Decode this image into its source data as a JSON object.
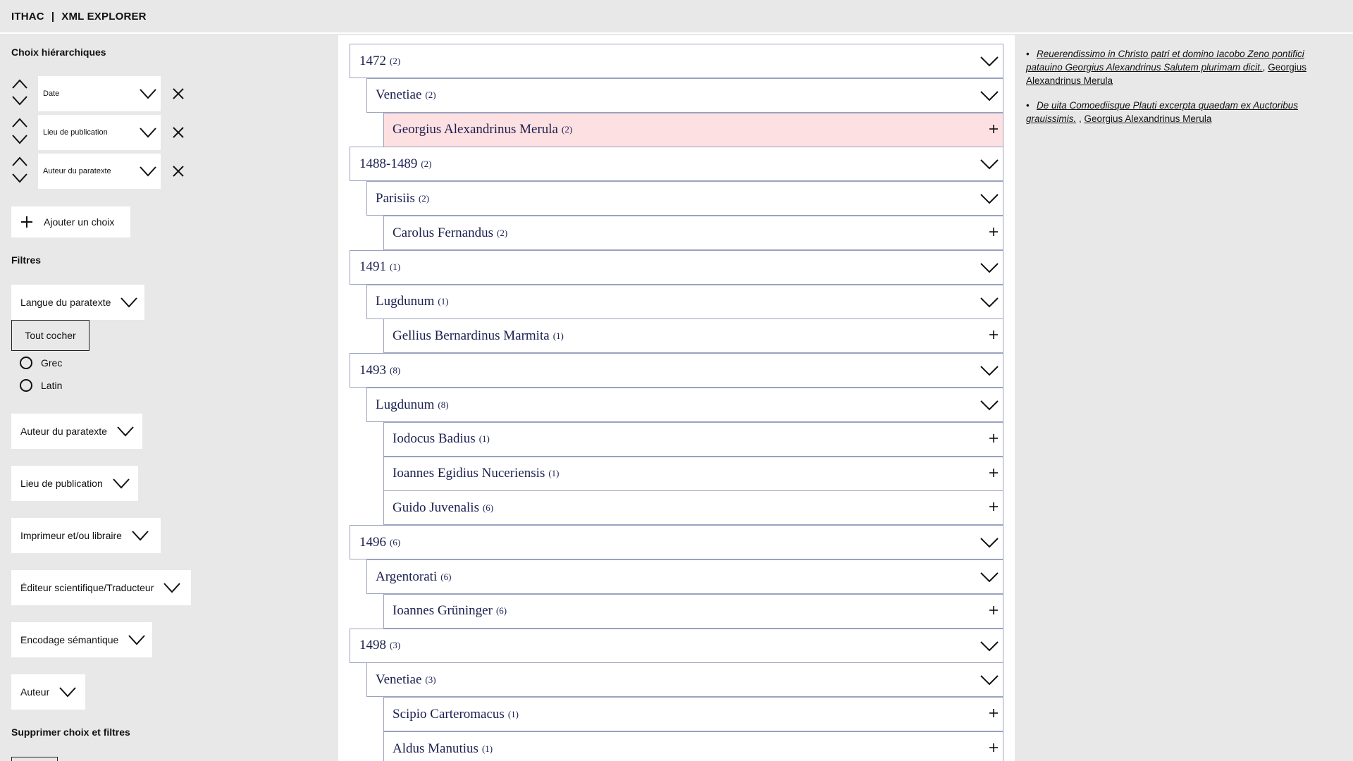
{
  "header": {
    "brand": "ITHAC",
    "separator": "|",
    "title": "XML EXPLORER"
  },
  "left": {
    "hier_title": "Choix hiérarchiques",
    "hier_choices": [
      "Date",
      "Lieu de publication",
      "Auteur du paratexte"
    ],
    "add_label": "Ajouter un choix",
    "filters_title": "Filtres",
    "filters": [
      "Langue du paratexte",
      "Auteur du paratexte",
      "Lieu de publication",
      "Imprimeur et/ou libraire",
      "Éditeur scientifique/Traducteur",
      "Encodage sémantique",
      "Auteur"
    ],
    "tout_cocher": "Tout cocher",
    "langues": [
      "Grec",
      "Latin"
    ],
    "reset_title": "Supprimer choix et filtres"
  },
  "tree": [
    {
      "level": 0,
      "label": "1472",
      "count": "(2)",
      "type": "expand"
    },
    {
      "level": 1,
      "label": "Venetiae",
      "count": "(2)",
      "type": "expand"
    },
    {
      "level": 2,
      "label": "Georgius Alexandrinus Merula",
      "count": "(2)",
      "type": "leaf",
      "selected": true
    },
    {
      "level": 0,
      "label": "1488-1489",
      "count": "(2)",
      "type": "expand"
    },
    {
      "level": 1,
      "label": "Parisiis",
      "count": "(2)",
      "type": "expand"
    },
    {
      "level": 2,
      "label": "Carolus Fernandus",
      "count": "(2)",
      "type": "leaf"
    },
    {
      "level": 0,
      "label": "1491",
      "count": "(1)",
      "type": "expand"
    },
    {
      "level": 1,
      "label": "Lugdunum",
      "count": "(1)",
      "type": "expand"
    },
    {
      "level": 2,
      "label": "Gellius Bernardinus Marmita",
      "count": "(1)",
      "type": "leaf"
    },
    {
      "level": 0,
      "label": "1493",
      "count": "(8)",
      "type": "expand"
    },
    {
      "level": 1,
      "label": "Lugdunum",
      "count": "(8)",
      "type": "expand"
    },
    {
      "level": 2,
      "label": "Iodocus Badius",
      "count": "(1)",
      "type": "leaf"
    },
    {
      "level": 2,
      "label": "Ioannes Egidius Nuceriensis",
      "count": "(1)",
      "type": "leaf"
    },
    {
      "level": 2,
      "label": "Guido Juvenalis",
      "count": "(6)",
      "type": "leaf"
    },
    {
      "level": 0,
      "label": "1496",
      "count": "(6)",
      "type": "expand"
    },
    {
      "level": 1,
      "label": "Argentorati",
      "count": "(6)",
      "type": "expand"
    },
    {
      "level": 2,
      "label": "Ioannes Grüninger",
      "count": "(6)",
      "type": "leaf"
    },
    {
      "level": 0,
      "label": "1498",
      "count": "(3)",
      "type": "expand"
    },
    {
      "level": 1,
      "label": "Venetiae",
      "count": "(3)",
      "type": "expand"
    },
    {
      "level": 2,
      "label": "Scipio Carteromacus",
      "count": "(1)",
      "type": "leaf"
    },
    {
      "level": 2,
      "label": "Aldus Manutius",
      "count": "(1)",
      "type": "leaf"
    }
  ],
  "results": [
    {
      "title": "Reuerendissimo in Christo patri et domino Iacobo Zeno pontifici patauino Georgius Alexandrinus Salutem plurimam dicit.",
      "author": "Georgius Alexandrinus Merula"
    },
    {
      "title": "De uita Comoediisque Plauti excerpta quaedam ex Auctoribus grauissimis.",
      "author": "Georgius Alexandrinus Merula"
    }
  ],
  "icons": {
    "up": "chevron-up-icon",
    "down": "chevron-down-icon",
    "close": "close-icon",
    "plus": "plus-icon"
  }
}
